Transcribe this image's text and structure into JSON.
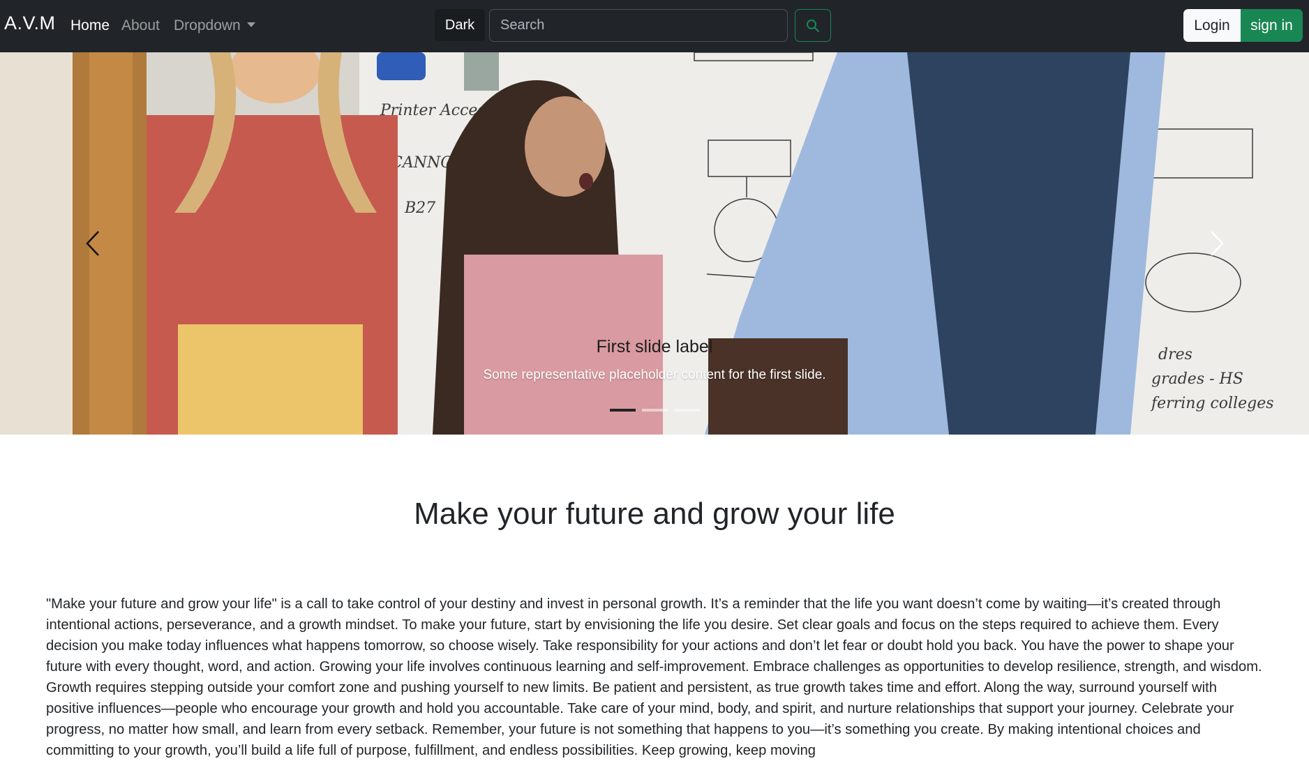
{
  "navbar": {
    "brand": "A.V.M",
    "links": [
      "Home",
      "About",
      "Dropdown"
    ],
    "theme_button": "Dark",
    "search_placeholder": "Search",
    "login_label": "Login",
    "signin_label": "sign in"
  },
  "carousel": {
    "slide_title": "First slide label",
    "slide_text": "Some representative placeholder content for the first slide.",
    "indicator_count": 3,
    "active_index": 0
  },
  "content": {
    "heading": "Make your future and grow your life",
    "paragraph": "\"Make your future and grow your life\" is a call to take control of your destiny and invest in personal growth. It’s a reminder that the life you want doesn’t come by waiting—it’s created through intentional actions, perseverance, and a growth mindset. To make your future, start by envisioning the life you desire. Set clear goals and focus on the steps required to achieve them. Every decision you make today influences what happens tomorrow, so choose wisely. Take responsibility for your actions and don’t let fear or doubt hold you back. You have the power to shape your future with every thought, word, and action. Growing your life involves continuous learning and self-improvement. Embrace challenges as opportunities to develop resilience, strength, and wisdom. Growth requires stepping outside your comfort zone and pushing yourself to new limits. Be patient and persistent, as true growth takes time and effort. Along the way, surround yourself with positive influences—people who encourage your growth and hold you accountable. Take care of your mind, body, and spirit, and nurture relationships that support your journey. Celebrate your progress, no matter how small, and learn from every setback. Remember, your future is not something that happens to you—it’s something you create. By making intentional choices and committing to your growth, you’ll build a life full of purpose, fulfillment, and endless possibilities. Keep growing, keep moving"
  },
  "colors": {
    "navbar_bg": "#212529",
    "success": "#198754",
    "light": "#f8f9fa"
  },
  "icons": {
    "search": "search-icon",
    "prev": "chevron-left-icon",
    "next": "chevron-right-icon",
    "caret": "caret-down-icon"
  }
}
